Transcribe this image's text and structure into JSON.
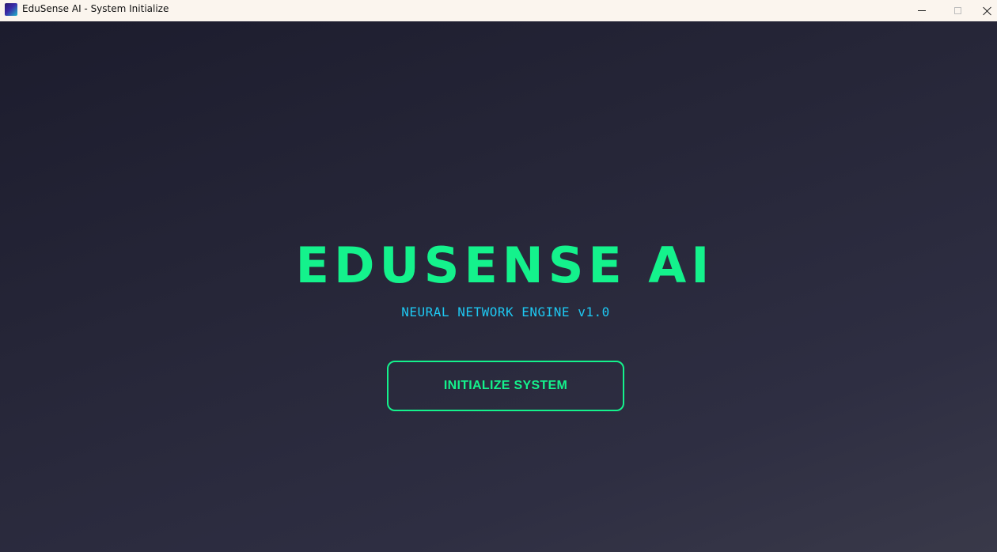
{
  "window": {
    "title": "EduSense AI - System Initialize",
    "icon": "app-icon",
    "controls": {
      "minimize_icon": "minimize-icon",
      "maximize_icon": "maximize-icon",
      "close_icon": "close-icon"
    }
  },
  "hero": {
    "title": "EDUSENSE AI",
    "subtitle": "NEURAL NETWORK ENGINE v1.0",
    "button_label": "INITIALIZE SYSTEM"
  },
  "colors": {
    "accent_green": "#14f28c",
    "accent_cyan": "#1ec8f2",
    "background_dark": "#1c1c2d",
    "background_light": "#393949",
    "titlebar": "#fbf5ee"
  }
}
